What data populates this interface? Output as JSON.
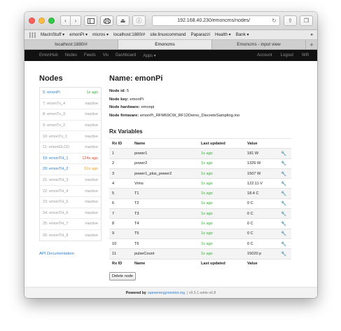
{
  "browser": {
    "url": "192.168.40.230/emoncms/nodes/",
    "bookmarks": [
      "MacInStuff ▾",
      "emonPi ▾",
      "micros ▾",
      "localhost:1880/#",
      "site:linuxcommand",
      "Paparazzi",
      "Health ▾",
      "Bank ▾"
    ],
    "bookmarks_more": "»",
    "tabs": [
      {
        "label": "localhost:1880/#",
        "active": false
      },
      {
        "label": "Emoncms",
        "active": true
      },
      {
        "label": "Emoncms - input view",
        "active": false
      }
    ],
    "tab_add": "+"
  },
  "appnav": {
    "items": [
      "EmonHub",
      "Nodes",
      "Feeds",
      "Vis",
      "Dashboard",
      "Apps ▾"
    ],
    "right_items": [
      "Account",
      "Logout",
      "Wifi"
    ]
  },
  "sidebar": {
    "title": "Nodes",
    "nodes": [
      {
        "name": "5: emonPi",
        "status": "1s ago",
        "status_color": "green",
        "name_color": "blue"
      },
      {
        "name": "7: emonTx_4",
        "status": "inactive",
        "status_color": "grey",
        "name_color": "grey"
      },
      {
        "name": "8: emonTx_3",
        "status": "inactive",
        "status_color": "grey",
        "name_color": "grey"
      },
      {
        "name": "9: emonTx_2",
        "status": "inactive",
        "status_color": "grey",
        "name_color": "grey"
      },
      {
        "name": "10: emonTx_1",
        "status": "inactive",
        "status_color": "grey",
        "name_color": "grey"
      },
      {
        "name": "11: emonGLCD",
        "status": "inactive",
        "status_color": "grey",
        "name_color": "grey"
      },
      {
        "name": "19: emonTH_1",
        "status": "124s ago",
        "status_color": "red",
        "name_color": "blue"
      },
      {
        "name": "20: emonTH_2",
        "status": "51s ago",
        "status_color": "orange",
        "name_color": "blue"
      },
      {
        "name": "21: emonTH_3",
        "status": "inactive",
        "status_color": "grey",
        "name_color": "grey"
      },
      {
        "name": "22: emonTH_4",
        "status": "inactive",
        "status_color": "grey",
        "name_color": "grey"
      },
      {
        "name": "23: emonTH_5",
        "status": "inactive",
        "status_color": "grey",
        "name_color": "grey"
      },
      {
        "name": "24: emonTH_6",
        "status": "inactive",
        "status_color": "grey",
        "name_color": "grey"
      },
      {
        "name": "25: emonTH_7",
        "status": "inactive",
        "status_color": "grey",
        "name_color": "grey"
      },
      {
        "name": "26: emonTH_8",
        "status": "inactive",
        "status_color": "grey",
        "name_color": "grey"
      }
    ],
    "api_link": "API Documentation"
  },
  "main": {
    "title": "Name: emonPi",
    "meta": [
      {
        "label": "Node id:",
        "value": "5"
      },
      {
        "label": "Node key:",
        "value": "emonPi"
      },
      {
        "label": "Node hardware:",
        "value": "emonpi"
      },
      {
        "label": "Node firmware:",
        "value": "emonPi_RFM69CW_RF12Demo_DiscreteSampling.ino"
      }
    ],
    "rx_title": "Rx Variables",
    "columns": [
      "Rx ID",
      "Name",
      "Last updated",
      "Value"
    ],
    "rows": [
      {
        "id": "1",
        "name": "power1",
        "updated": "1s ago",
        "value": "181 W"
      },
      {
        "id": "2",
        "name": "power2",
        "updated": "1s ago",
        "value": "1326 W"
      },
      {
        "id": "3",
        "name": "power1_plus_power2",
        "updated": "1s ago",
        "value": "1507 W"
      },
      {
        "id": "4",
        "name": "Vrms",
        "updated": "1s ago",
        "value": "122.11 V"
      },
      {
        "id": "5",
        "name": "T1",
        "updated": "1s ago",
        "value": "18.4 C"
      },
      {
        "id": "6",
        "name": "T2",
        "updated": "1s ago",
        "value": "0 C"
      },
      {
        "id": "7",
        "name": "T3",
        "updated": "1s ago",
        "value": "0 C"
      },
      {
        "id": "8",
        "name": "T4",
        "updated": "1s ago",
        "value": "0 C"
      },
      {
        "id": "9",
        "name": "T5",
        "updated": "1s ago",
        "value": "0 C"
      },
      {
        "id": "10",
        "name": "T6",
        "updated": "1s ago",
        "value": "0 C"
      },
      {
        "id": "11",
        "name": "pulseCount",
        "updated": "1s ago",
        "value": "15020 p"
      }
    ],
    "delete_button": "Delete node"
  },
  "footer": {
    "prefix": "Powered by",
    "link": "openenergymonitor.org",
    "version": "| v9.5.1-write-v6.8"
  },
  "colors": {
    "green": "#3fae3f",
    "red": "#e04a2c",
    "orange": "#f09a1a",
    "blue": "#2a7fcf",
    "grey": "#9a9a9a"
  }
}
